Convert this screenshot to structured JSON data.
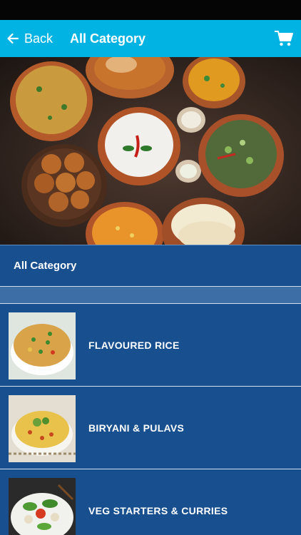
{
  "app_bar": {
    "back_label": "Back",
    "title": "All Category",
    "back_icon": "arrow-left-icon",
    "cart_icon": "shopping-cart-icon"
  },
  "section": {
    "title": "All Category"
  },
  "categories": [
    {
      "label": "FLAVOURED RICE"
    },
    {
      "label": "BIRYANI & PULAVS"
    },
    {
      "label": "VEG STARTERS & CURRIES"
    }
  ],
  "colors": {
    "app_bar": "#00b3e3",
    "background": "#174f8f",
    "band": "#3d6ea6",
    "status_bar": "#050505"
  }
}
